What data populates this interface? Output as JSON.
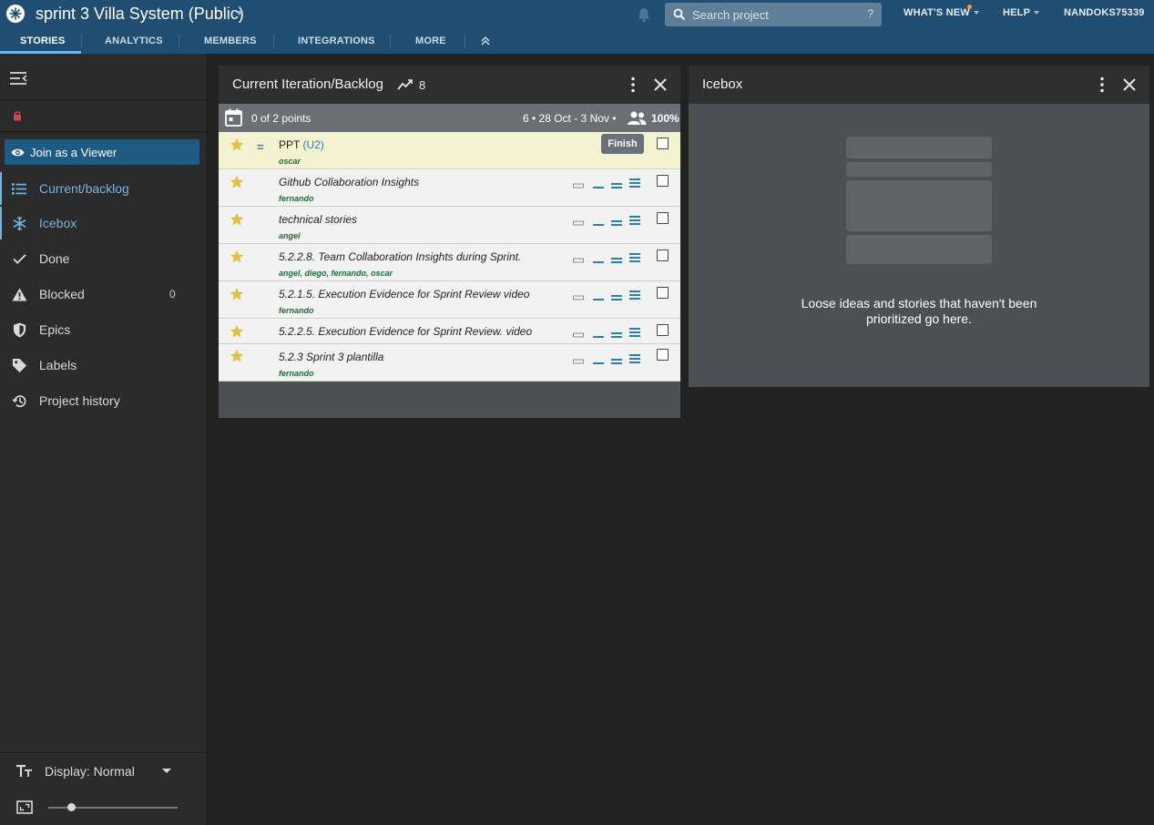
{
  "header": {
    "project_title": "sprint 3 Villa System  (Public)",
    "search_placeholder": "Search project",
    "search_help": "?",
    "whats_new": "WHAT'S NEW",
    "help": "HELP",
    "user": "NANDOKS75339"
  },
  "tabs": [
    {
      "label": "STORIES",
      "active": true
    },
    {
      "label": "ANALYTICS",
      "active": false
    },
    {
      "label": "MEMBERS",
      "active": false
    },
    {
      "label": "INTEGRATIONS",
      "active": false
    },
    {
      "label": "MORE",
      "active": false
    }
  ],
  "sidebar": {
    "join_label": "Join as a Viewer",
    "items": [
      {
        "label": "Current/backlog",
        "icon": "list-icon",
        "selected": true
      },
      {
        "label": "Icebox",
        "icon": "snowflake-icon",
        "selected": true
      },
      {
        "label": "Done",
        "icon": "check-icon",
        "selected": false
      },
      {
        "label": "Blocked",
        "icon": "warning-icon",
        "selected": false,
        "count": "0"
      },
      {
        "label": "Epics",
        "icon": "shield-icon",
        "selected": false
      },
      {
        "label": "Labels",
        "icon": "tag-icon",
        "selected": false
      },
      {
        "label": "Project history",
        "icon": "history-icon",
        "selected": false
      }
    ],
    "display_label": "Display: Normal",
    "zoom_level": 0.18
  },
  "backlog": {
    "title": "Current Iteration/Backlog",
    "velocity": "8",
    "points": "0 of 2 points",
    "iteration_dates": "6 • 28 Oct - 3 Nov •",
    "team_strength": "100%",
    "stories": [
      {
        "title": "PPT",
        "code": "(U2)",
        "owners": "oscar",
        "state": "started",
        "finish_label": "Finish"
      },
      {
        "title": "Github Collaboration Insights",
        "owners": "fernando",
        "state": "unestimated"
      },
      {
        "title": "technical stories",
        "owners": "angel",
        "state": "unestimated"
      },
      {
        "title": "5.2.2.8. Team Collaboration Insights during Sprint.",
        "owners": "angel, diego, fernando, oscar",
        "state": "unestimated"
      },
      {
        "title": "5.2.1.5. Execution Evidence for Sprint Review video",
        "owners": "fernando",
        "state": "unestimated"
      },
      {
        "title": "5.2.2.5. Execution Evidence for Sprint Review. video",
        "owners": "",
        "state": "unestimated"
      },
      {
        "title": "5.2.3 Sprint 3 plantilla",
        "owners": "fernando",
        "state": "unestimated"
      }
    ]
  },
  "icebox": {
    "title": "Icebox",
    "empty_message": "Loose ideas and stories that haven't been prioritized go here."
  },
  "colors": {
    "header_bg": "#1f4e72",
    "accent": "#6fb3e6",
    "star": "#e2c046",
    "owner_text": "#1d6b3c"
  }
}
